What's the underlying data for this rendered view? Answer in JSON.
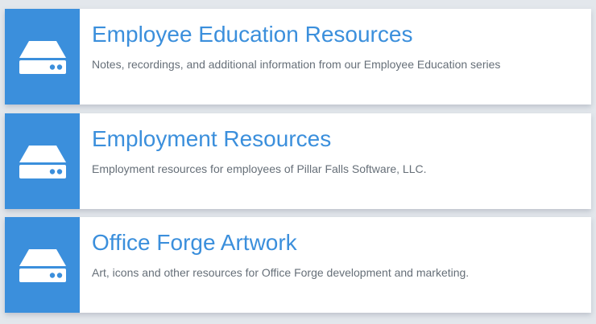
{
  "resources": [
    {
      "icon": "hard-drive-icon",
      "title": "Employee Education Resources",
      "description": "Notes, recordings, and additional information from our Employee Education series"
    },
    {
      "icon": "hard-drive-icon",
      "title": "Employment Resources",
      "description": "Employment resources for employees of Pillar Falls Software, LLC."
    },
    {
      "icon": "hard-drive-icon",
      "title": "Office Forge Artwork",
      "description": "Art, icons and other resources for Office Forge development and marketing."
    }
  ],
  "colors": {
    "accent": "#3b8fdc",
    "background": "#e3e7ec",
    "card": "#ffffff",
    "description_text": "#666f78"
  }
}
